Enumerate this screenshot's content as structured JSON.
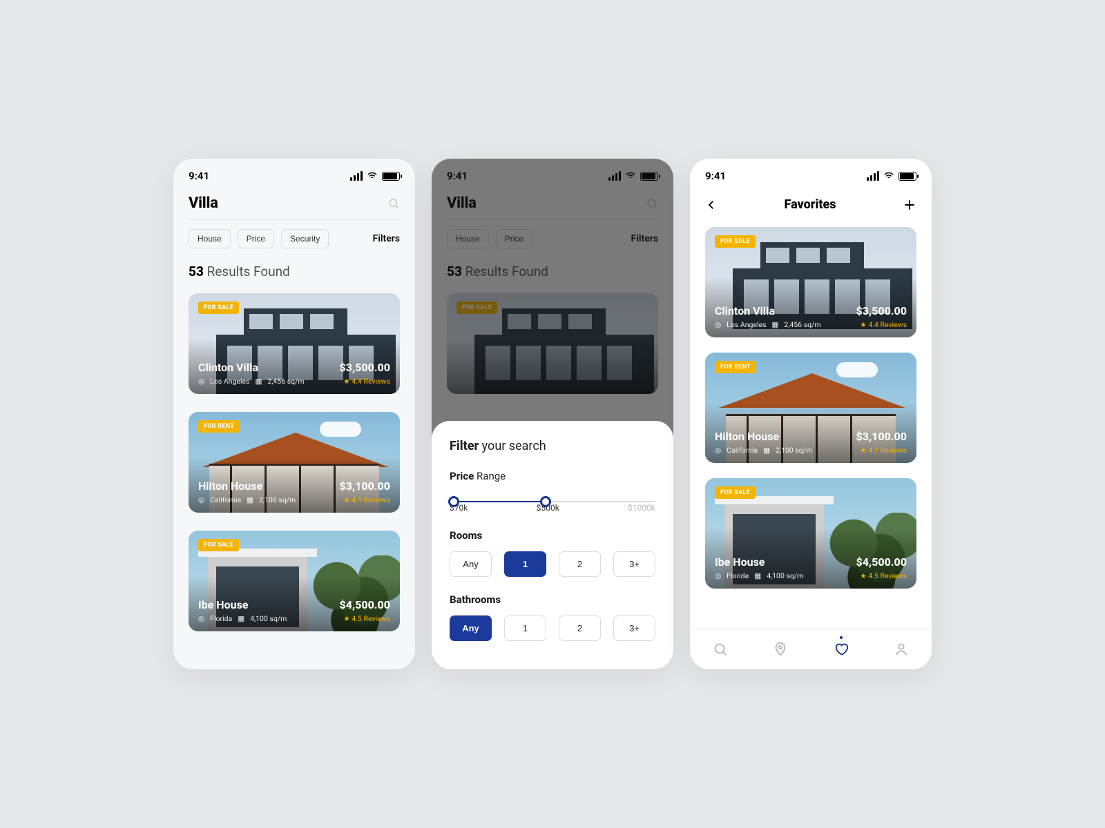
{
  "status": {
    "time": "9:41"
  },
  "screen1": {
    "search_term": "Villa",
    "chips": [
      "House",
      "Price",
      "Security"
    ],
    "filters_label": "Filters",
    "results_count": "53",
    "results_label": "Results Found",
    "listings": [
      {
        "badge": "FOR SALE",
        "name": "Clinton Villa",
        "city": "Los Angeles",
        "area": "2,456 sq/m",
        "price": "$3,500.00",
        "rating": "4.4 Reviews"
      },
      {
        "badge": "FOR RENT",
        "name": "Hilton House",
        "city": "California",
        "area": "2,100 sq/m",
        "price": "$3,100.00",
        "rating": "4.1 Reviews"
      },
      {
        "badge": "FOR SALE",
        "name": "Ibe House",
        "city": "Florida",
        "area": "4,100 sq/m",
        "price": "$4,500.00",
        "rating": "4.5 Reviews"
      }
    ]
  },
  "screen2": {
    "search_term": "Villa",
    "chips": [
      "House",
      "Price"
    ],
    "filters_label": "Filters",
    "results_count": "53",
    "results_label": "Results Found",
    "dim_listing_badge": "FOR SALE",
    "sheet": {
      "title_bold": "Filter",
      "title_rest": "your search",
      "price_bold": "Price",
      "price_rest": "Range",
      "slider_min": "$70k",
      "slider_mid": "$500k",
      "slider_max": "$1000k",
      "rooms_label": "Rooms",
      "rooms_options": [
        "Any",
        "1",
        "2",
        "3+"
      ],
      "rooms_selected_index": 1,
      "bath_label": "Bathrooms",
      "bath_options": [
        "Any",
        "1",
        "2",
        "3+"
      ],
      "bath_selected_index": 0
    }
  },
  "screen3": {
    "title": "Favorites",
    "listings": [
      {
        "badge": "FOR SALE",
        "name": "Clinton Villa",
        "city": "Los Angeles",
        "area": "2,456 sq/m",
        "price": "$3,500.00",
        "rating": "4.4 Reviews"
      },
      {
        "badge": "FOR RENT",
        "name": "Hilton House",
        "city": "California",
        "area": "2,100 sq/m",
        "price": "$3,100.00",
        "rating": "4.1 Reviews"
      },
      {
        "badge": "FOR SALE",
        "name": "Ibe House",
        "city": "Florida",
        "area": "4,100 sq/m",
        "price": "$4,500.00",
        "rating": "4.5 Reviews"
      }
    ]
  }
}
